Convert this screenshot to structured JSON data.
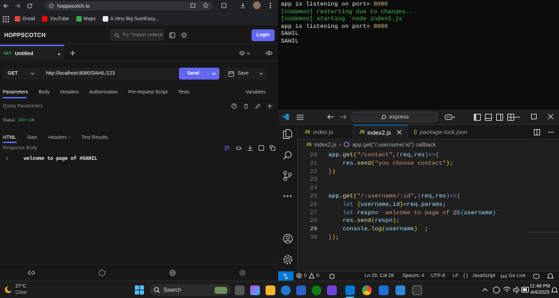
{
  "browser": {
    "url": "hoppscotch.io",
    "bookmarks": [
      {
        "label": "Gmail",
        "color": "#ea4335"
      },
      {
        "label": "YouTube",
        "color": "#ff0000"
      },
      {
        "label": "Maps",
        "color": "#34a853"
      },
      {
        "label": "A Very Big SumEasy...",
        "color": "#2b2b2b"
      }
    ]
  },
  "hoppscotch": {
    "logo": "HOPPSCOTCH",
    "search_placeholder": "Try \"Import collecti",
    "login_label": "Login",
    "tab": {
      "method": "GET",
      "name": "Untitled"
    },
    "request": {
      "method": "GET",
      "url": "http://localhost:8080/SAHIL/123",
      "send_label": "Send",
      "save_label": "Save"
    },
    "request_tabs": [
      "Parameters",
      "Body",
      "Headers",
      "Authorization",
      "Pre-request Script",
      "Tests"
    ],
    "variables_label": "Variables",
    "query_params_label": "Query Parameters",
    "status": {
      "label": "Status:",
      "value": "200 • OK"
    },
    "response_tabs": [
      "HTML",
      "Raw",
      "Headers",
      "Test Results"
    ],
    "response_body_label": "Response Body",
    "response_line_no": "1",
    "response_text": "welcome to page of #SAHIL",
    "accent": "#6366f1"
  },
  "terminal": {
    "lines": [
      {
        "text": "app is listening on port= ",
        "value": "8080",
        "color": "white"
      },
      {
        "text": "[nodemon] restarting due to changes...",
        "color": "green"
      },
      {
        "text": "[nodemon] starting `node index2.js`",
        "color": "green"
      },
      {
        "text": "app is listening on port= ",
        "value": "8080",
        "color": "white"
      },
      {
        "text": "SAHIL",
        "color": "white"
      },
      {
        "text": "SAHIL",
        "color": "white"
      }
    ]
  },
  "vscode": {
    "search": "express",
    "tabs": [
      {
        "label": "index.js",
        "icon": "JS"
      },
      {
        "label": "index2.js",
        "icon": "JS",
        "active": true
      },
      {
        "label": "package-lock.json",
        "icon": "{}"
      }
    ],
    "breadcrumb": [
      "index2.js",
      "app.get(\"/:username/:id\") callback"
    ],
    "code": [
      {
        "n": "20",
        "html": "<span class='vr'>app</span><span class='pn'>.</span><span class='fn'>get</span><span class='br'>(</span><span class='st'>\"/contact\"</span><span class='pn'>,</span><span class='br2'>(</span><span class='vr'>req</span><span class='pn'>,</span><span class='vr'>res</span><span class='br2'>)</span><span class='kw'>=></span><span class='br2'>{</span>"
      },
      {
        "n": "21",
        "html": "    <span class='vr'>res</span><span class='pn'>.</span><span class='fn'>send</span><span class='br'>(</span><span class='st'>\"you choose contact\"</span><span class='br'>)</span><span class='pn'>;</span>"
      },
      {
        "n": "22",
        "html": "<span class='br2'>}</span><span class='br'>)</span>"
      },
      {
        "n": "23",
        "html": ""
      },
      {
        "n": "24",
        "html": ""
      },
      {
        "n": "25",
        "html": "<span class='vr'>app</span><span class='pn'>.</span><span class='fn'>get</span><span class='br'>(</span><span class='st'>\"/:username/:id\"</span><span class='pn'>,</span><span class='br2'>(</span><span class='vr'>req</span><span class='pn'>,</span><span class='vr'>res</span><span class='br2'>)</span><span class='kw'>=></span><span class='br2'>{</span>"
      },
      {
        "n": "26",
        "html": "    <span class='kw'>let</span> <span class='br'>{</span><span class='vr'>username</span><span class='pn'>,</span><span class='vr'>id</span><span class='br'>}</span><span class='pn'>=</span><span class='vr'>req</span><span class='pn'>.</span><span class='vr'>params</span><span class='pn'>;</span>"
      },
      {
        "n": "27",
        "html": "    <span class='kw'>let</span> <span class='vr'>respn</span><span class='pn'>=</span><span class='st'>` welcome to page of @</span><span class='kw'>${</span><span class='vr'>username</span><span class='kw'>}</span><span class='st'>`</span>"
      },
      {
        "n": "28",
        "html": "    <span class='vr'>res</span><span class='pn'>.</span><span class='fn'>send</span><span class='br'>(</span><span class='vr'>respn</span><span class='br'>)</span><span class='pn'>;</span>"
      },
      {
        "n": "29",
        "html": "    <span class='vr'>console</span><span class='pn'>.</span><span class='fn'>log</span><span class='br'>(</span><span class='vr'>username</span><span class='br'>)</span>  <span class='pn'>;</span>",
        "current": true
      },
      {
        "n": "30",
        "html": "<span class='br2'>}</span><span class='br'>)</span><span class='pn'>;</span>"
      }
    ],
    "status": {
      "errors": "0",
      "warnings": "0",
      "position": "Ln 29, Col 28",
      "spaces": "Spaces: 4",
      "encoding": "UTF-8",
      "eol": "LF",
      "language": "JavaScript",
      "golive": "Go Live"
    }
  },
  "taskbar": {
    "temp": "27°C",
    "weather": "Clear",
    "search_label": "Search",
    "time": "11:48 PM",
    "date": "4/4/2025"
  }
}
